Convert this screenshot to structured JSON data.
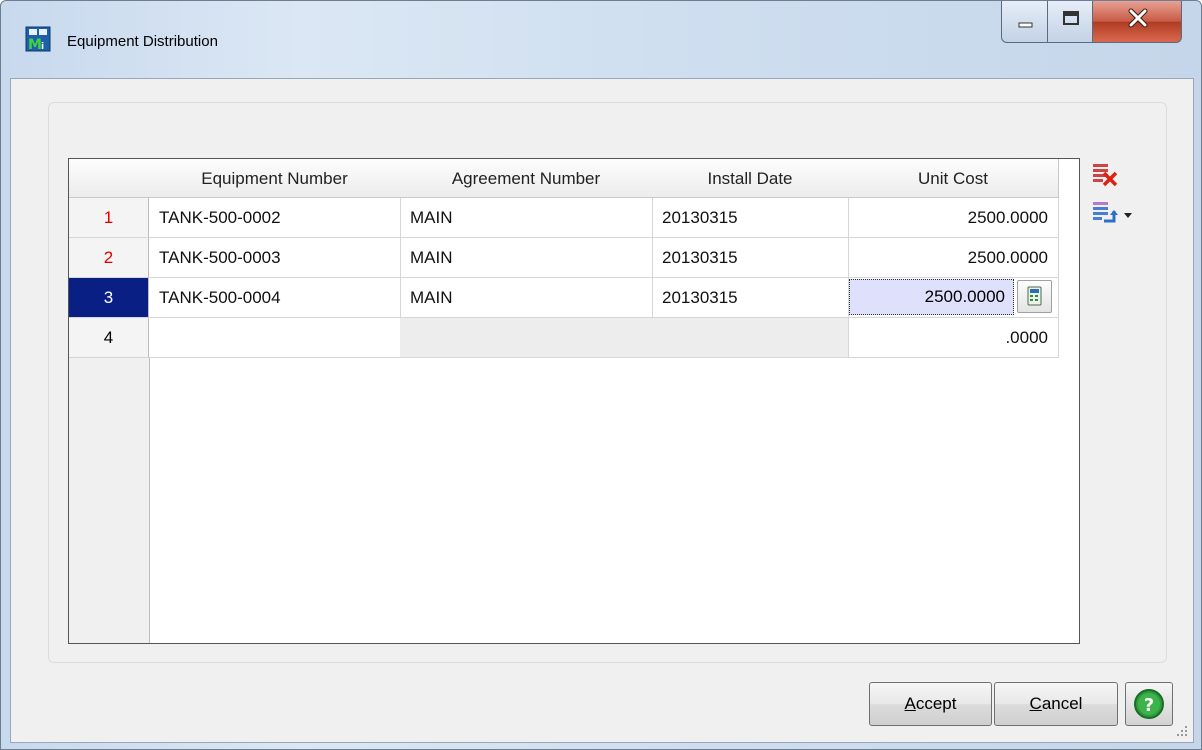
{
  "window": {
    "title": "Equipment Distribution",
    "app_icon": "mas-app-icon"
  },
  "grid": {
    "columns": [
      "Equipment Number",
      "Agreement Number",
      "Install Date",
      "Unit Cost"
    ],
    "rows": [
      {
        "num": "1",
        "equipment": "TANK-500-0002",
        "agreement": "MAIN",
        "install_date": "20130315",
        "unit_cost": "2500.0000"
      },
      {
        "num": "2",
        "equipment": "TANK-500-0003",
        "agreement": "MAIN",
        "install_date": "20130315",
        "unit_cost": "2500.0000"
      },
      {
        "num": "3",
        "equipment": "TANK-500-0004",
        "agreement": "MAIN",
        "install_date": "20130315",
        "unit_cost": "2500.0000"
      },
      {
        "num": "4",
        "equipment": "",
        "agreement": "",
        "install_date": "",
        "unit_cost": ".0000"
      }
    ],
    "selected_row": 3
  },
  "side_tools": {
    "delete_icon": "delete-row-icon",
    "insert_icon": "insert-row-icon"
  },
  "buttons": {
    "accept_first": "A",
    "accept_rest": "ccept",
    "cancel_first": "C",
    "cancel_rest": "ancel"
  },
  "colors": {
    "selected_row_header": "#0a1f84",
    "row_number_red": "#e00000",
    "edit_cell_bg": "#dfe0fb",
    "help_green": "#2e9a3c"
  }
}
